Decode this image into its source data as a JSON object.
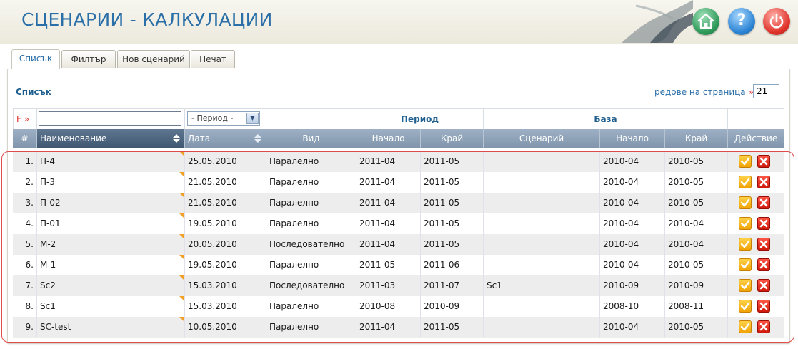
{
  "header": {
    "title": "СЦЕНАРИИ - КАЛКУЛАЦИИ"
  },
  "tabs": [
    {
      "label": "Списък",
      "active": true
    },
    {
      "label": "Филтър",
      "active": false
    },
    {
      "label": "Нов сценарий",
      "active": false
    },
    {
      "label": "Печат",
      "active": false
    }
  ],
  "panel": {
    "title": "Списък",
    "rows_label": "редове на страница",
    "rows_arrow": "»",
    "rows_value": "21"
  },
  "filters": {
    "label": "F »",
    "name_value": "",
    "period_select": "- Период -"
  },
  "groups": {
    "period": "Период",
    "base": "База"
  },
  "columns": {
    "num": "#",
    "name": "Наименование",
    "date": "Дата",
    "kind": "Вид",
    "start": "Начало",
    "end": "Край",
    "scenario": "Сценарий",
    "base_start": "Начало",
    "base_end": "Край",
    "action": "Действие"
  },
  "rows": [
    {
      "num": "1.",
      "name": "П-4",
      "date": "25.05.2010",
      "kind": "Паралелно",
      "start": "2011-04",
      "end": "2011-05",
      "scenario": "",
      "base_start": "2010-04",
      "base_end": "2010-05"
    },
    {
      "num": "2.",
      "name": "П-3",
      "date": "21.05.2010",
      "kind": "Паралелно",
      "start": "2011-04",
      "end": "2011-05",
      "scenario": "",
      "base_start": "2010-04",
      "base_end": "2010-05"
    },
    {
      "num": "3.",
      "name": "П-02",
      "date": "21.05.2010",
      "kind": "Паралелно",
      "start": "2011-04",
      "end": "2011-05",
      "scenario": "",
      "base_start": "2010-04",
      "base_end": "2010-05"
    },
    {
      "num": "4.",
      "name": "П-01",
      "date": "19.05.2010",
      "kind": "Паралелно",
      "start": "2011-04",
      "end": "2011-05",
      "scenario": "",
      "base_start": "2010-04",
      "base_end": "2010-04"
    },
    {
      "num": "5.",
      "name": "М-2",
      "date": "20.05.2010",
      "kind": "Последователно",
      "start": "2011-04",
      "end": "2011-05",
      "scenario": "",
      "base_start": "2010-04",
      "base_end": "2010-04"
    },
    {
      "num": "6.",
      "name": "М-1",
      "date": "19.05.2010",
      "kind": "Паралелно",
      "start": "2011-05",
      "end": "2011-06",
      "scenario": "",
      "base_start": "2010-04",
      "base_end": "2010-05"
    },
    {
      "num": "7.",
      "name": "Sc2",
      "date": "15.03.2010",
      "kind": "Последователно",
      "start": "2011-03",
      "end": "2011-07",
      "scenario": "Sc1",
      "base_start": "2010-09",
      "base_end": "2010-09"
    },
    {
      "num": "8.",
      "name": "Sc1",
      "date": "15.03.2010",
      "kind": "Паралелно",
      "start": "2010-08",
      "end": "2010-09",
      "scenario": "",
      "base_start": "2008-10",
      "base_end": "2008-11"
    },
    {
      "num": "9.",
      "name": "SC-test",
      "date": "10.05.2010",
      "kind": "Паралелно",
      "start": "2011-04",
      "end": "2011-05",
      "scenario": "",
      "base_start": "2010-04",
      "base_end": "2010-05"
    }
  ]
}
